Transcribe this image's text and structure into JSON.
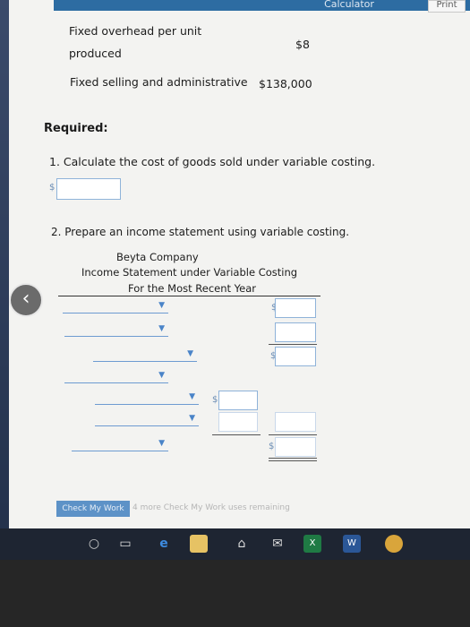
{
  "header": {
    "calculator_label": "Calculator",
    "print_label": "Print"
  },
  "data_lines": [
    {
      "label": "Fixed overhead per unit",
      "label2": "produced",
      "value": "$8"
    },
    {
      "label": "Fixed selling and administrative",
      "value": "$138,000"
    }
  ],
  "required": {
    "title": "Required:",
    "q1": "1. Calculate the cost of goods sold under variable costing.",
    "q1_currency": "$",
    "q2": "2. Prepare an income statement using variable costing."
  },
  "statement": {
    "company": "Beyta Company",
    "title": "Income Statement under Variable Costing",
    "period": "For the Most Recent Year",
    "currency": "$",
    "dropdown_arrow": "▼"
  },
  "footer": {
    "check_label": "Check My Work",
    "check_note": "4 more Check My Work uses remaining"
  },
  "taskbar": {
    "icons": [
      "search-icon",
      "task-view-icon",
      "edge-icon",
      "file-explorer-icon",
      "store-icon",
      "mail-icon",
      "excel-icon",
      "word-icon",
      "chrome-icon"
    ]
  },
  "colors": {
    "accent": "#5d92c7",
    "underline": "#6d9bd1"
  }
}
